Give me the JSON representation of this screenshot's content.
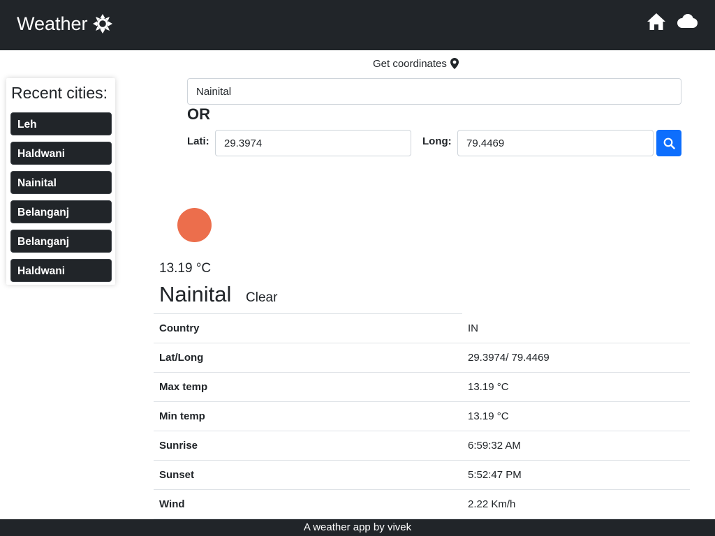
{
  "navbar": {
    "brand": "Weather",
    "brand_icon": "sun-icon",
    "icons": [
      "home-icon",
      "cloud-icon"
    ]
  },
  "sidebar": {
    "title": "Recent cities:",
    "cities": [
      "Leh",
      "Haldwani",
      "Nainital",
      "Belanganj",
      "Belanganj",
      "Haldwani"
    ]
  },
  "search": {
    "get_coordinates": "Get coordinates",
    "city_value": "Nainital",
    "or": "OR",
    "lat_label": "Lati:",
    "lat_value": "29.3974",
    "long_label": "Long:",
    "long_value": "79.4469"
  },
  "weather": {
    "icon_color": "#ec6e4c",
    "temp": "13.19 °C",
    "city": "Nainital",
    "condition": "Clear",
    "details": [
      {
        "key": "Country",
        "value": "IN"
      },
      {
        "key": "Lat/Long",
        "value": "29.3974/ 79.4469"
      },
      {
        "key": "Max temp",
        "value": "13.19 °C"
      },
      {
        "key": "Min temp",
        "value": "13.19 °C"
      },
      {
        "key": "Sunrise",
        "value": "6:59:32 AM"
      },
      {
        "key": "Sunset",
        "value": "5:52:47 PM"
      },
      {
        "key": "Wind",
        "value": "2.22 Km/h"
      }
    ]
  },
  "footer": {
    "text": "A weather app by vivek"
  },
  "colors": {
    "dark": "#212529",
    "primary": "#0d6efd",
    "border": "#dee2e6"
  }
}
